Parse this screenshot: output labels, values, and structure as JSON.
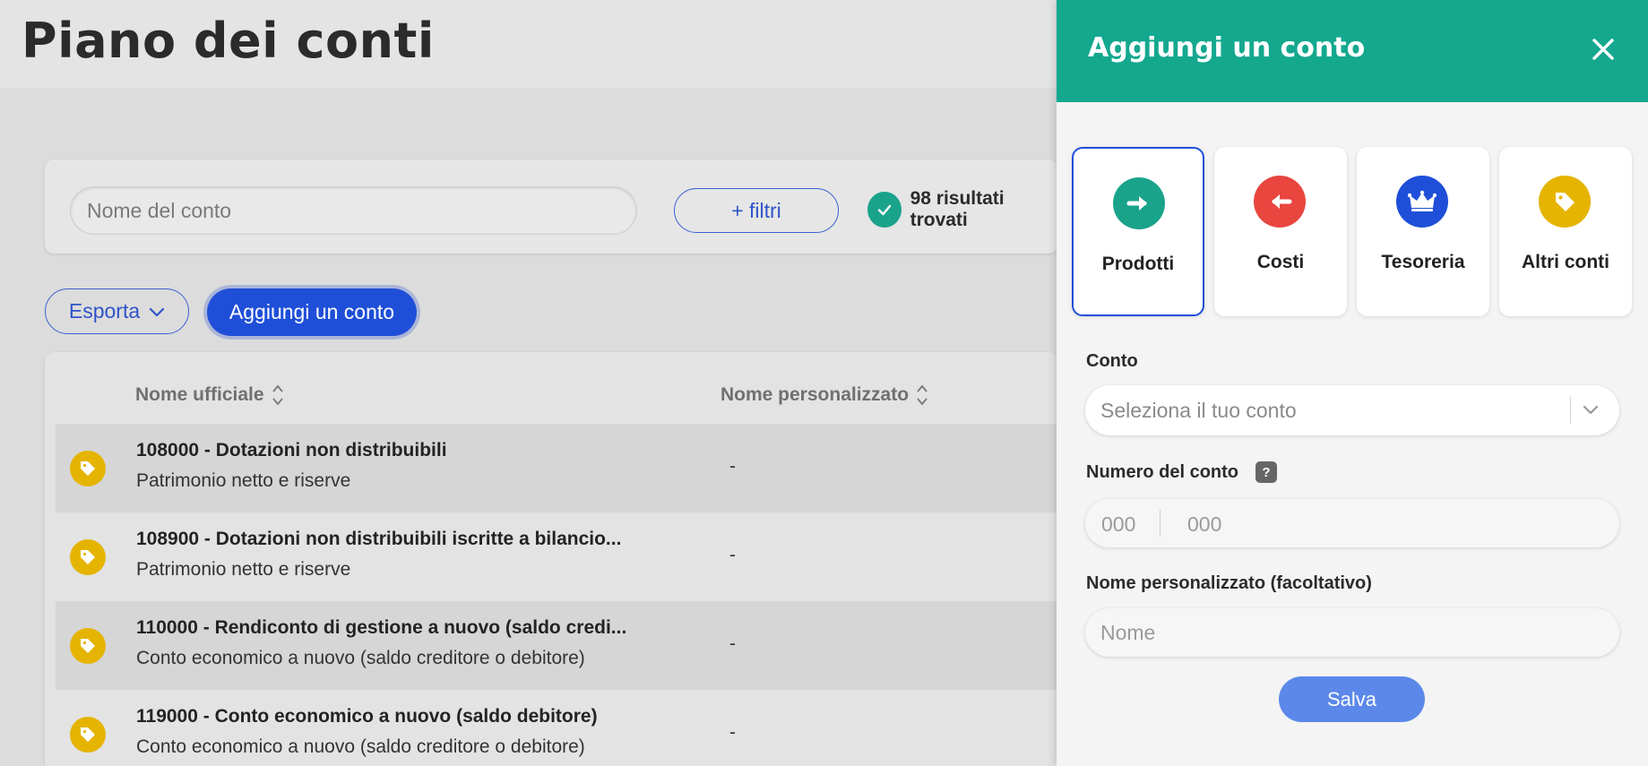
{
  "page": {
    "title": "Piano dei conti"
  },
  "filters": {
    "search_placeholder": "Nome del conto",
    "filters_label": "+ filtri",
    "results_text": "98 risultati trovati"
  },
  "actions": {
    "export_label": "Esporta",
    "add_label": "Aggiungi un conto"
  },
  "table": {
    "columns": [
      "Nome ufficiale",
      "Nome personalizzato"
    ],
    "rows": [
      {
        "title": "108000 - Dotazioni non distribuibili",
        "subtitle": "Patrimonio netto e riserve",
        "custom": "-"
      },
      {
        "title": "108900 - Dotazioni non distribuibili iscritte a bilancio...",
        "subtitle": "Patrimonio netto e riserve",
        "custom": "-"
      },
      {
        "title": "110000 - Rendiconto di gestione a nuovo (saldo credi...",
        "subtitle": "Conto economico a nuovo (saldo creditore o debitore)",
        "custom": "-"
      },
      {
        "title": "119000 - Conto economico a nuovo (saldo debitore)",
        "subtitle": "Conto economico a nuovo (saldo creditore o debitore)",
        "custom": "-"
      }
    ],
    "row_icon": "tag-icon"
  },
  "panel": {
    "title": "Aggiungi un conto",
    "types": [
      {
        "label": "Prodotti",
        "icon": "arrow-right-icon",
        "color": "#1aa38b",
        "selected": true
      },
      {
        "label": "Costi",
        "icon": "arrow-left-icon",
        "color": "#e8463f",
        "selected": false
      },
      {
        "label": "Tesoreria",
        "icon": "crown-icon",
        "color": "#1f4fd8",
        "selected": false
      },
      {
        "label": "Altri conti",
        "icon": "tag-icon",
        "color": "#e5b400",
        "selected": false
      }
    ],
    "account_label": "Conto",
    "account_placeholder": "Seleziona il tuo conto",
    "number_label": "Numero del conto",
    "help_badge": "?",
    "number_placeholder_1": "000",
    "number_placeholder_2": "000",
    "custom_name_label": "Nome personalizzato (facoltativo)",
    "custom_name_placeholder": "Nome",
    "save_label": "Salva"
  },
  "colors": {
    "accent_green": "#14a88f",
    "primary_blue": "#1f4fd8",
    "save_blue": "#5c88ea"
  }
}
